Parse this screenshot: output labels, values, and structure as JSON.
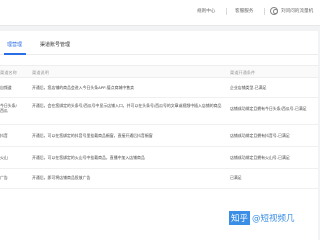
{
  "header": {
    "nav_rules": "规则中心",
    "nav_help": "客服服务",
    "user_name": "刘问问的流量机"
  },
  "tabs": [
    {
      "label": "理营理",
      "active": true
    },
    {
      "label": "渠道账号管理",
      "active": false
    }
  ],
  "table": {
    "columns": [
      "渠道名称",
      "渠道说明",
      "渠道开通条件"
    ],
    "rows": [
      {
        "name": "自频道",
        "desc": "开通后，您店铺的商品会进入今日头条APP-值点商城中售卖",
        "cond": "企业店铺类型-已满足"
      },
      {
        "name": "今日头条/\n西瓜",
        "desc": "开通后，会在您绑定的头条号/西瓜号中显示店铺入口，并可以在头条号/西瓜号的文章或视频中插入店铺的商品",
        "cond": "店铺成功绑定且拥有今日头条/西瓜号-已满足"
      },
      {
        "name": "抖音",
        "desc": "开通后，可以在您绑定的抖音号里挂载商品橱窗，直接开通后抖音橱窗",
        "cond": "店铺成功绑定且拥有抖音号-已满足"
      },
      {
        "name": "火山",
        "desc": "开通后，可以在您绑定的火山号中挂载商品，直播中加入店铺商品",
        "cond": "店铺成功绑定且拥有火山号-已满足"
      },
      {
        "name": "广告",
        "desc": "开通后，即可将店铺商品投放广告",
        "cond": "已满足"
      }
    ]
  },
  "watermark": {
    "zhihu": "知乎",
    "handle": "@短视频几"
  },
  "colors": {
    "accent": "#2b6de5",
    "watermark": "#3a8ee6"
  }
}
